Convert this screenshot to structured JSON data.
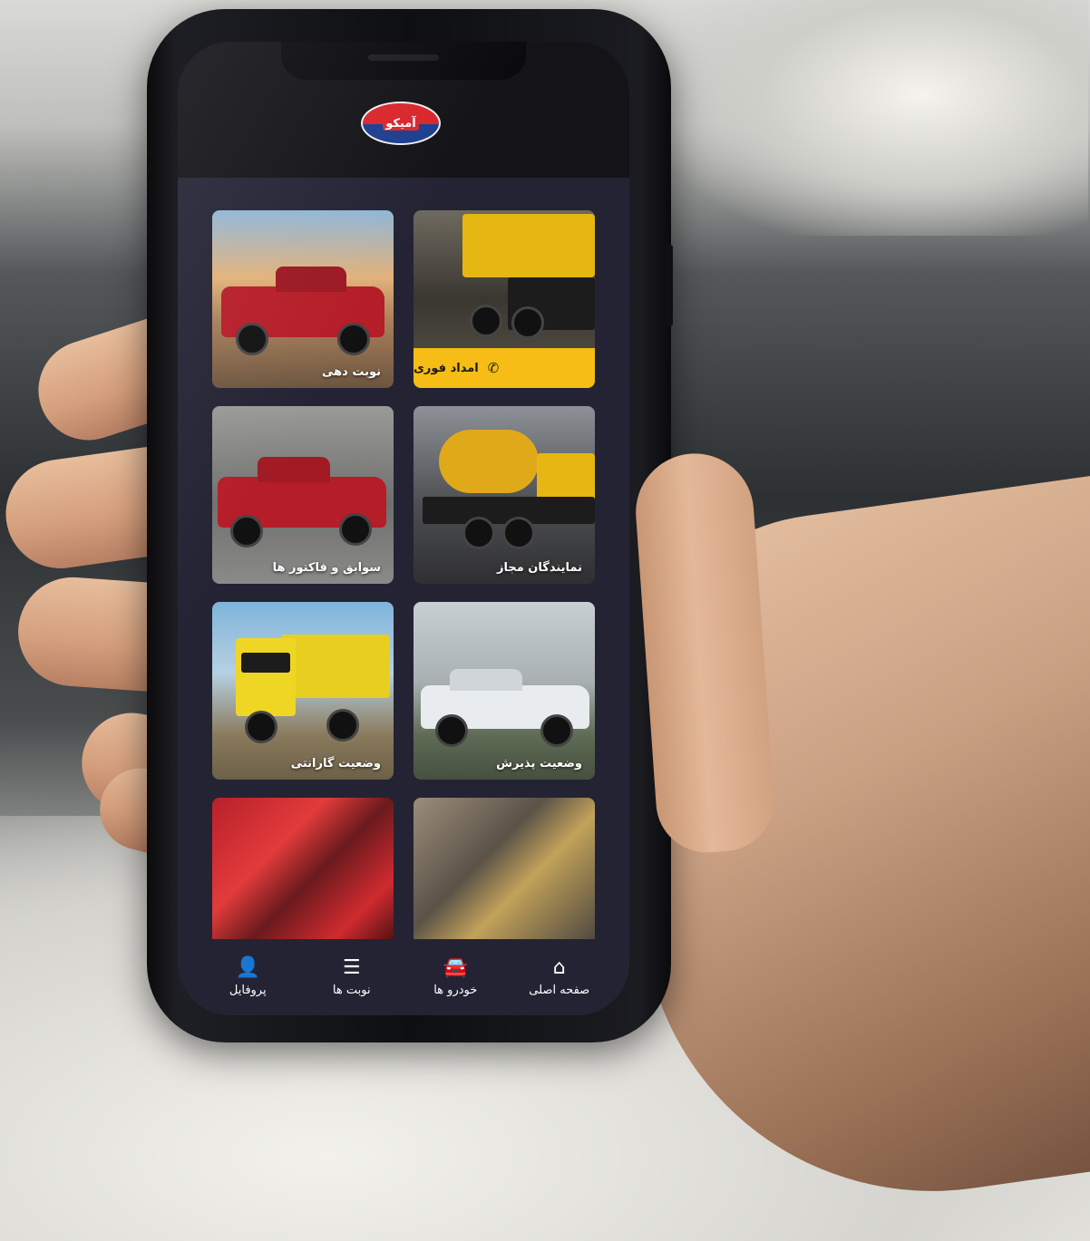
{
  "app": {
    "brand_text": "آمیکو"
  },
  "tiles": [
    {
      "label": "امداد فوری",
      "icon": "phone-icon"
    },
    {
      "label": "نوبت دهی"
    },
    {
      "label": "نمایندگان مجاز"
    },
    {
      "label": "سوابق و فاکتور ها"
    },
    {
      "label": "وضعیت پذیرش"
    },
    {
      "label": "وضعیت گارانتی"
    },
    {
      "label": ""
    },
    {
      "label": ""
    }
  ],
  "bottom_nav": [
    {
      "label": "صفحه اصلی",
      "icon": "home-icon",
      "glyph": "⌂"
    },
    {
      "label": "خودرو ها",
      "icon": "car-icon",
      "glyph": "🚘"
    },
    {
      "label": "نوبت ها",
      "icon": "list-icon",
      "glyph": "☰"
    },
    {
      "label": "پروفایل",
      "icon": "user-icon",
      "glyph": "👤"
    }
  ],
  "colors": {
    "screen_bg": "#242334",
    "accent_yellow": "#f5bd15",
    "logo_red": "#d9262b",
    "logo_blue": "#1c3e8f"
  }
}
